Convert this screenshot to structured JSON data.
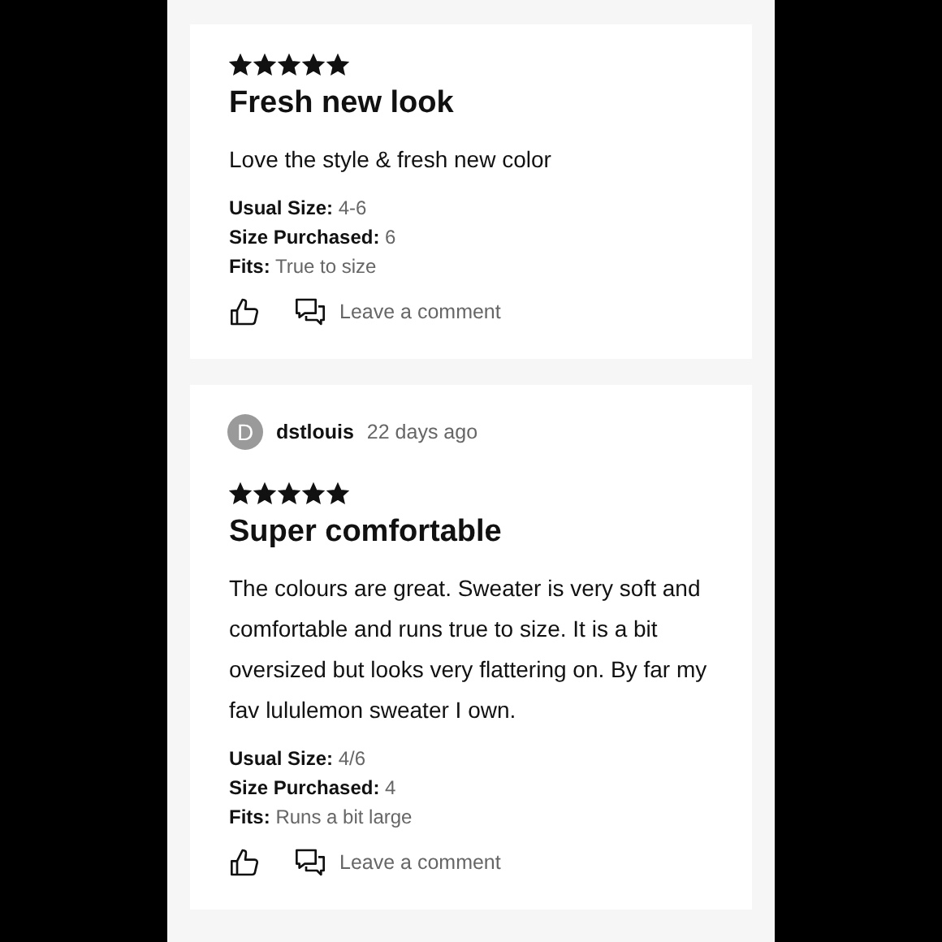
{
  "reviews": [
    {
      "stars": 5,
      "title": "Fresh new look",
      "body": "Love the style & fresh new color",
      "details": [
        {
          "label": "Usual Size:",
          "value": "4-6"
        },
        {
          "label": "Size Purchased:",
          "value": "6"
        },
        {
          "label": "Fits:",
          "value": "True to size"
        }
      ],
      "comment_label": "Leave a comment"
    },
    {
      "author": {
        "initial": "D",
        "name": "dstlouis",
        "time": "22 days ago"
      },
      "stars": 5,
      "title": "Super comfortable",
      "body": "The colours are great. Sweater is very soft and comfortable and runs true to size. It is a bit oversized but looks very flattering on. By far my fav lululemon sweater I own.",
      "details": [
        {
          "label": "Usual Size:",
          "value": "4/6"
        },
        {
          "label": "Size Purchased:",
          "value": "4"
        },
        {
          "label": "Fits:",
          "value": "Runs a bit large"
        }
      ],
      "comment_label": "Leave a comment"
    }
  ]
}
